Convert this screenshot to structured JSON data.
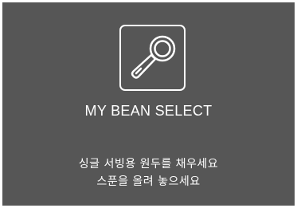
{
  "screen": {
    "background_color": "#565656",
    "text_color": "#ffffff",
    "icon": "coffee-scoop-icon",
    "title": "MY BEAN SELECT",
    "instructions": {
      "line1": "싱글 서빙용 원두를 채우세요",
      "line2": "스푼을 올려 놓으세요"
    }
  }
}
